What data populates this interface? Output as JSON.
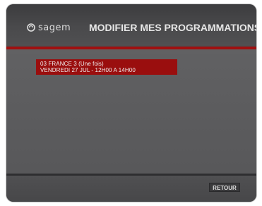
{
  "header": {
    "logo_text": "sagem",
    "title": "MODIFIER MES PROGRAMMATIONS"
  },
  "recordings": [
    {
      "line1": "03 FRANCE 3 (Une fois)",
      "line2": "VENDREDI 27 JUL - 12H00 A 14H00"
    }
  ],
  "footer": {
    "back_label": "RETOUR"
  },
  "colors": {
    "accent_red": "#9a0e0e",
    "header_bg": "#3c3c3e",
    "content_bg": "#5c5c5e"
  },
  "icons": {
    "logo_mark": "sagem-logo-icon"
  }
}
